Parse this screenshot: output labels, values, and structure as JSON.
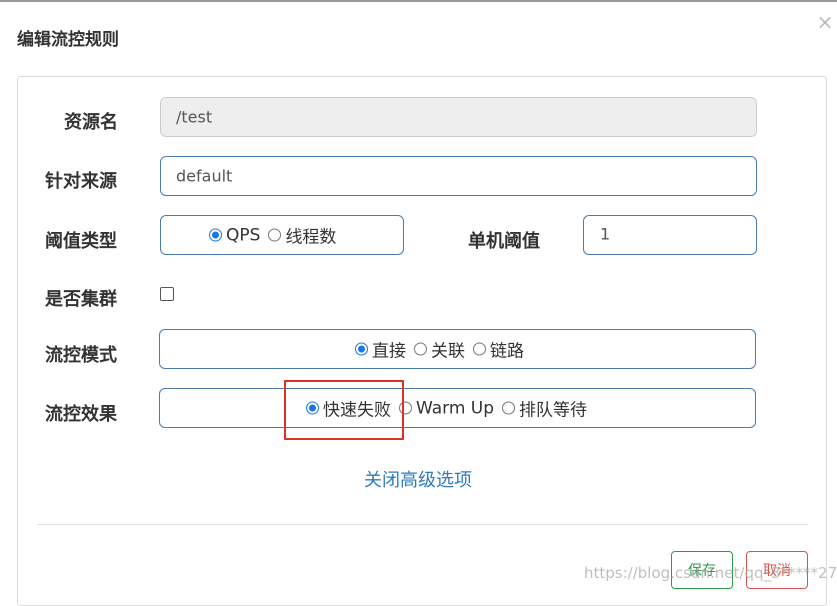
{
  "dialog": {
    "title": "编辑流控规则",
    "close_glyph": "×"
  },
  "form": {
    "resource_name": {
      "label": "资源名",
      "value": "/test"
    },
    "limit_app": {
      "label": "针对来源",
      "value": "default"
    },
    "threshold_type": {
      "label": "阈值类型",
      "options": [
        "QPS",
        "线程数"
      ],
      "selected": "QPS"
    },
    "single_threshold": {
      "label": "单机阈值",
      "value": "1"
    },
    "cluster": {
      "label": "是否集群",
      "checked": false
    },
    "control_mode": {
      "label": "流控模式",
      "options": [
        "直接",
        "关联",
        "链路"
      ],
      "selected": "直接"
    },
    "control_effect": {
      "label": "流控效果",
      "options": [
        "快速失败",
        "Warm Up",
        "排队等待"
      ],
      "selected": "快速失败"
    }
  },
  "advanced_link": "关闭高级选项",
  "buttons": {
    "save": "保存",
    "cancel": "取消"
  },
  "watermark": "https://blog.csdn.net/qq_3*****27",
  "colors": {
    "accent": "#1a73e8",
    "link": "#2f7bbf",
    "save": "#2e9a47",
    "cancel": "#d9534f",
    "highlight": "#e0302a",
    "input_border": "#4a7bb0"
  }
}
